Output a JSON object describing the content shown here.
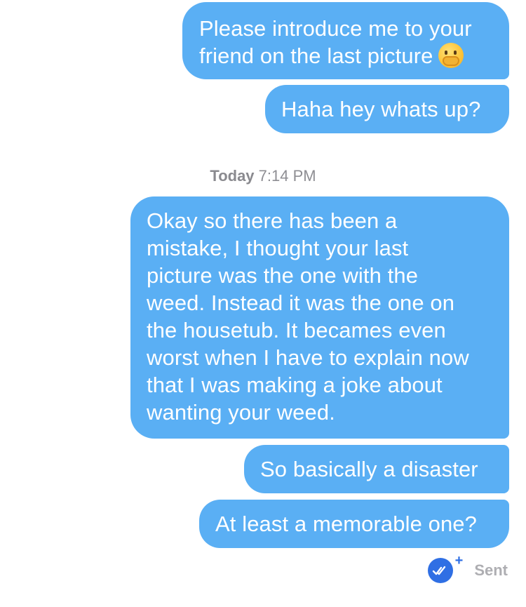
{
  "messages": [
    {
      "lines": [
        "Please introduce me to your",
        "friend on the last picture"
      ],
      "emoji": "hand-over-mouth-face"
    },
    {
      "text": "Haha hey whats up?"
    },
    {
      "lines": [
        "Okay so there has been a",
        "mistake, I thought your last",
        "picture was the one with the",
        "weed. Instead it was the one on",
        "the housetub. It becames even",
        "worst when I have to explain now",
        "that I was making a joke about",
        "wanting your weed."
      ]
    },
    {
      "text": "So basically a disaster"
    },
    {
      "text": "At least a memorable one?"
    }
  ],
  "timestamp": {
    "day": "Today",
    "time": "7:14 PM"
  },
  "status": {
    "icon": "double-check-icon",
    "plus": "+",
    "label": "Sent"
  },
  "colors": {
    "bubble": "#5aaff4",
    "read_icon": "#2f6fe4",
    "timestamp": "#8e8e93",
    "sent_label": "#aeaeb2"
  }
}
